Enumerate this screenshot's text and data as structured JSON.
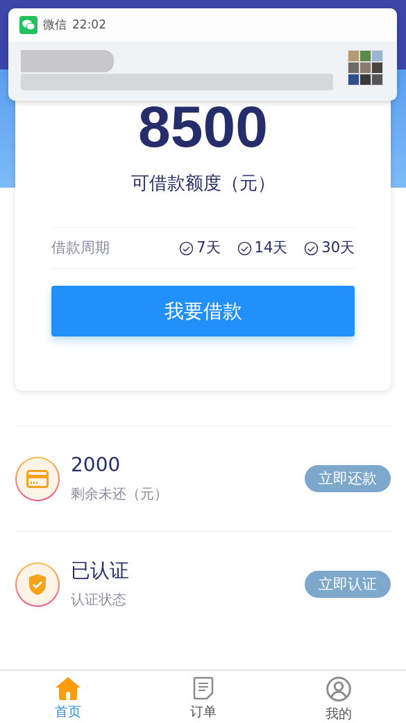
{
  "notification": {
    "app": "微信",
    "time": "22:02"
  },
  "loan": {
    "amount": "8500",
    "amount_label": "可借款额度（元）",
    "period_label": "借款周期",
    "periods": [
      "7天",
      "14天",
      "30天"
    ],
    "button": "我要借款"
  },
  "items": [
    {
      "kind": "repay",
      "value": "2000",
      "caption": "剩余未还（元）",
      "button": "立即还款"
    },
    {
      "kind": "verify",
      "value": "已认证",
      "caption": "认证状态",
      "button": "立即认证"
    }
  ],
  "tabs": [
    {
      "kind": "home",
      "label": "首页",
      "selected": true
    },
    {
      "kind": "orders",
      "label": "订单",
      "selected": false
    },
    {
      "kind": "mine",
      "label": "我的",
      "selected": false
    }
  ]
}
